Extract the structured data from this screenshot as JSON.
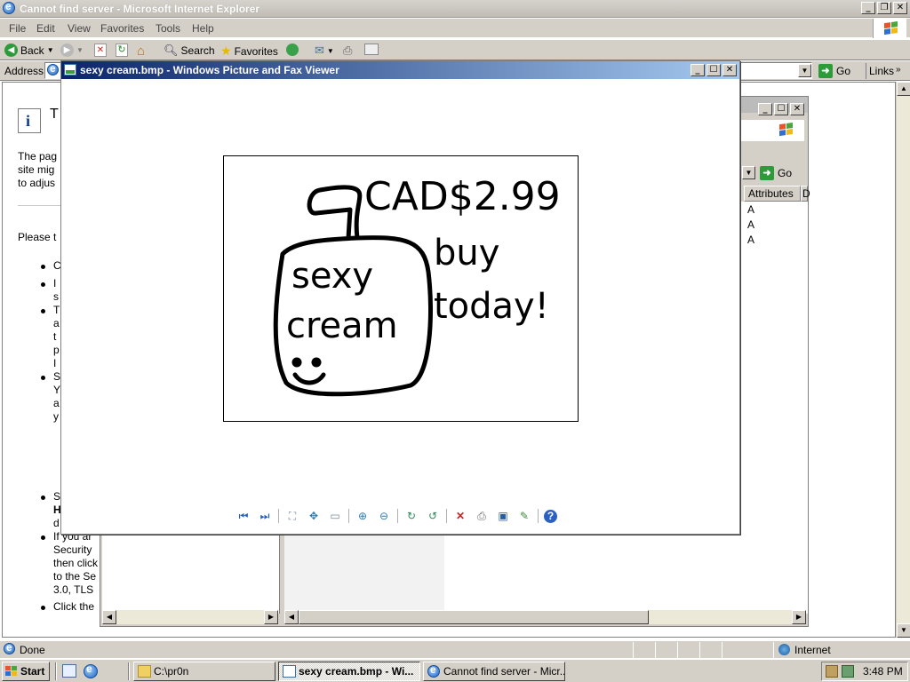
{
  "ie": {
    "title": "Cannot find server - Microsoft Internet Explorer",
    "menu": [
      "File",
      "Edit",
      "View",
      "Favorites",
      "Tools",
      "Help"
    ],
    "toolbar": {
      "back": "Back",
      "search": "Search",
      "favorites": "Favorites"
    },
    "address_label": "Address",
    "go_label": "Go",
    "links_label": "Links",
    "status_text": "Done",
    "zone_text": "Internet",
    "page": {
      "heading_fragment": "T",
      "para_lines": [
        "The pag",
        "site mig",
        "to adjus"
      ],
      "please_text": "Please t",
      "list_fragments": [
        "C",
        "I",
        "s",
        "T",
        "a",
        "t",
        "p",
        "I",
        "S",
        "Y",
        "a",
        "y",
        "S",
        "H",
        "d"
      ],
      "list_long": [
        "If you ar",
        "Security",
        "then click",
        "to the Se",
        "3.0, TLS"
      ],
      "last_item": "Click the"
    }
  },
  "explorer": {
    "go_label": "Go",
    "col_attributes": "Attributes",
    "col_next": "D",
    "attr_values": [
      "A",
      "A",
      "A"
    ]
  },
  "viewer": {
    "title": "sexy cream.bmp - Windows Picture and Fax Viewer",
    "image_text": {
      "price": "CAD$2.99",
      "line1": "buy",
      "line2": "today!",
      "product1": "sexy",
      "product2": "cream"
    },
    "toolbar_icons": [
      "previous-image-icon",
      "next-image-icon",
      "best-fit-icon",
      "actual-size-icon",
      "slideshow-icon",
      "zoom-in-icon",
      "zoom-out-icon",
      "rotate-clockwise-icon",
      "rotate-counterclockwise-icon",
      "delete-icon",
      "print-icon",
      "save-icon",
      "open-for-editing-icon",
      "help-icon"
    ]
  },
  "taskbar": {
    "start_label": "Start",
    "tasks": [
      "C:\\pr0n",
      "sexy cream.bmp - Wi...",
      "Cannot find server - Micr..."
    ],
    "clock": "3:48 PM"
  },
  "colors": {
    "title_active": "#0a246a",
    "title_active_end": "#a6caf0",
    "title_inactive": "#c0bcb4",
    "face": "#d4d0c8"
  }
}
